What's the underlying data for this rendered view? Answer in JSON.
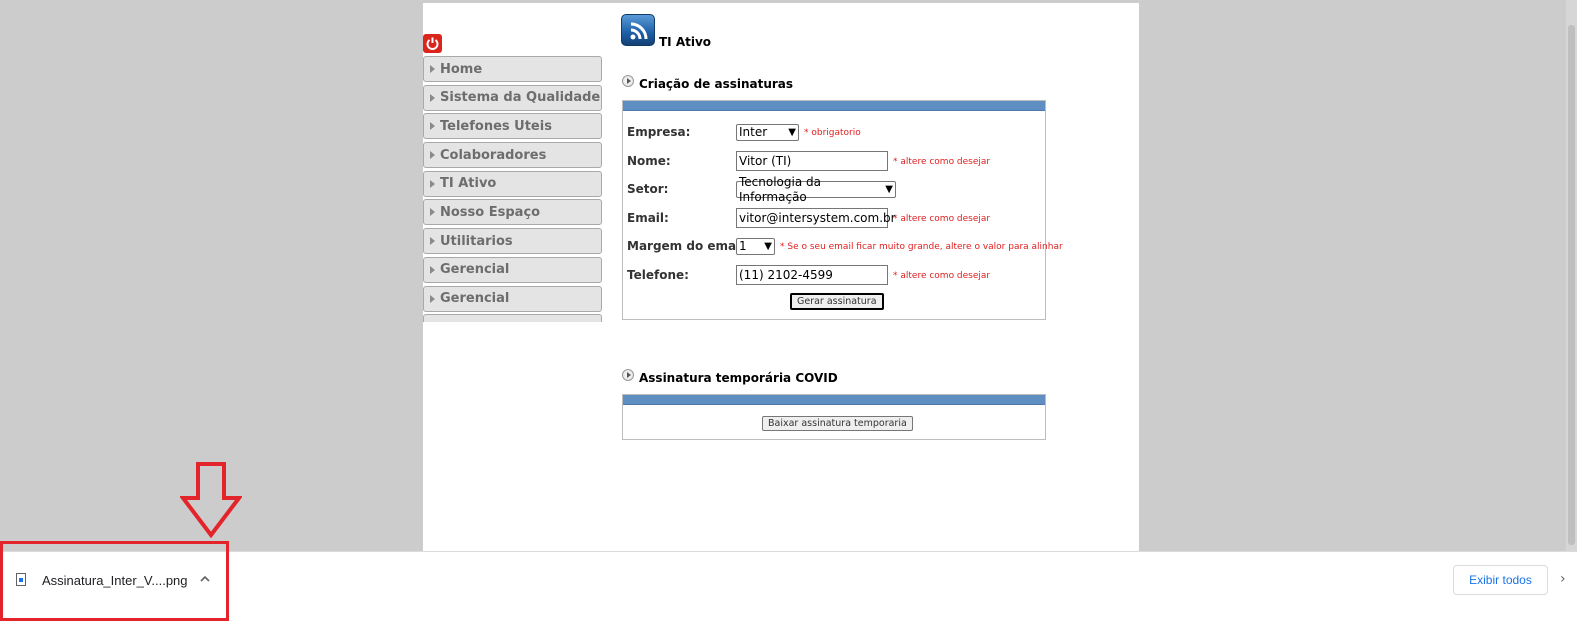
{
  "header": {
    "title": "TI Ativo"
  },
  "menu": {
    "items": [
      {
        "label": "Home"
      },
      {
        "label": "Sistema da Qualidade"
      },
      {
        "label": "Telefones Uteis"
      },
      {
        "label": "Colaboradores"
      },
      {
        "label": "TI Ativo"
      },
      {
        "label": "Nosso Espaço"
      },
      {
        "label": "Utilitarios"
      },
      {
        "label": "Gerencial"
      },
      {
        "label": "Gerencial"
      }
    ]
  },
  "signature_form": {
    "section_title": "Criação de assinaturas",
    "empresa": {
      "label": "Empresa:",
      "value": "Inter",
      "hint": "* obrigatorio"
    },
    "nome": {
      "label": "Nome:",
      "value": "Vitor (TI)",
      "hint": "* altere como desejar"
    },
    "setor": {
      "label": "Setor:",
      "value": "Tecnologia da Informação"
    },
    "email": {
      "label": "Email:",
      "value": "vitor@intersystem.com.br",
      "hint": "* altere como desejar"
    },
    "margem": {
      "label": "Margem do email:",
      "value": "1",
      "hint": "* Se o seu email ficar muito grande, altere o valor para alinhar"
    },
    "telefone": {
      "label": "Telefone:",
      "value": "(11) 2102-4599",
      "hint": "* altere como desejar"
    },
    "submit_label": "Gerar assinatura"
  },
  "covid_section": {
    "section_title": "Assinatura temporária COVID",
    "button_label": "Baixar assinatura temporaria"
  },
  "download_bar": {
    "file_name": "Assinatura_Inter_V....png",
    "show_all_label": "Exibir todos"
  },
  "colors": {
    "panel_bar": "#5f8fc2",
    "highlight": "#e3242b",
    "hint_text": "#e02020",
    "link_blue": "#1a73e8"
  },
  "icons": [
    "power-icon",
    "rss-icon",
    "file-icon",
    "chevron-up-icon",
    "down-arrow-icon",
    "close-icon"
  ]
}
